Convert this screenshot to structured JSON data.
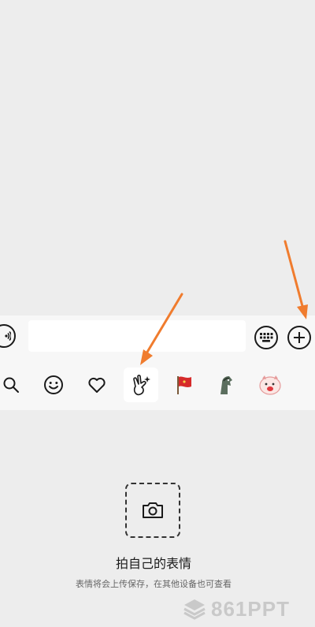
{
  "chat": {},
  "input_bar": {
    "text_value": "",
    "placeholder": ""
  },
  "tool_tabs": [
    {
      "icon": "search-icon"
    },
    {
      "icon": "emoji-face-icon"
    },
    {
      "icon": "heart-icon"
    },
    {
      "icon": "gesture-hand-icon",
      "active": true
    },
    {
      "icon": "red-flag-sticker-icon"
    },
    {
      "icon": "horse-sticker-icon"
    },
    {
      "icon": "cartoon-sticker-icon"
    }
  ],
  "panel": {
    "title": "拍自己的表情",
    "description": "表情将会上传保存，在其他设备也可查看"
  },
  "watermark": {
    "text": "861PPT"
  },
  "colors": {
    "background": "#ededed",
    "bar": "#f7f7f7",
    "arrow": "#f07c2e"
  }
}
